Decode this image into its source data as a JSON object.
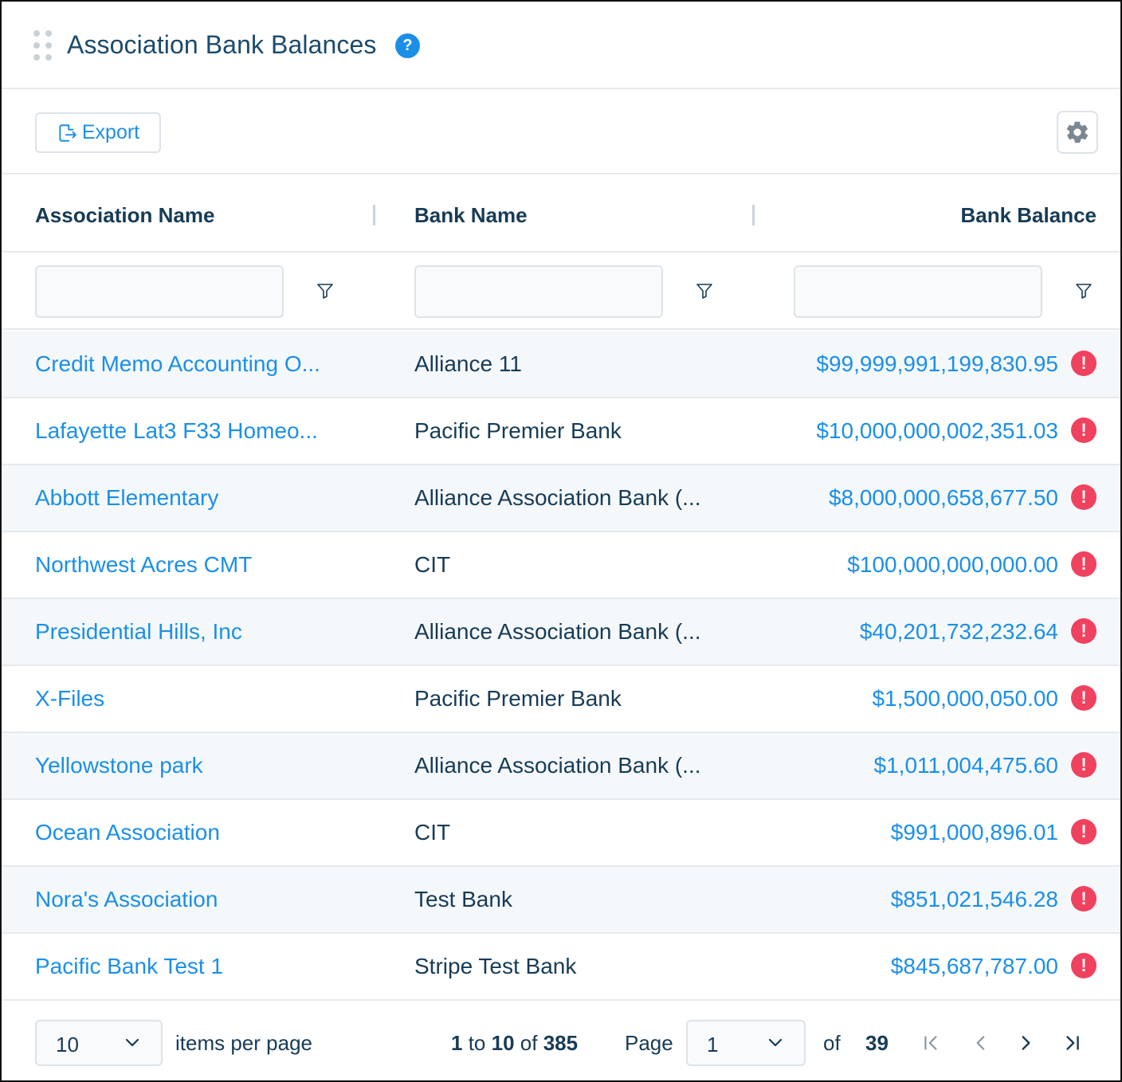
{
  "header": {
    "title": "Association Bank Balances",
    "help_glyph": "?"
  },
  "toolbar": {
    "export_label": "Export",
    "export_icon": "export-icon",
    "settings_icon": "gear-icon"
  },
  "columns": {
    "association_name": "Association Name",
    "bank_name": "Bank Name",
    "bank_balance": "Bank Balance"
  },
  "filters": {
    "association_value": "",
    "bank_value": "",
    "balance_value": ""
  },
  "rows": [
    {
      "association": "Credit Memo Accounting O...",
      "bank": "Alliance 11",
      "balance": "$99,999,991,199,830.95",
      "warning": "!"
    },
    {
      "association": "Lafayette Lat3 F33 Homeo...",
      "bank": "Pacific Premier Bank",
      "balance": "$10,000,000,002,351.03",
      "warning": "!"
    },
    {
      "association": "Abbott Elementary",
      "bank": "Alliance Association Bank (...",
      "balance": "$8,000,000,658,677.50",
      "warning": "!"
    },
    {
      "association": "Northwest Acres CMT",
      "bank": "CIT",
      "balance": "$100,000,000,000.00",
      "warning": "!"
    },
    {
      "association": "Presidential Hills, Inc",
      "bank": "Alliance Association Bank (...",
      "balance": "$40,201,732,232.64",
      "warning": "!"
    },
    {
      "association": "X-Files",
      "bank": "Pacific Premier Bank",
      "balance": "$1,500,000,050.00",
      "warning": "!"
    },
    {
      "association": "Yellowstone park",
      "bank": "Alliance Association Bank (...",
      "balance": "$1,011,004,475.60",
      "warning": "!"
    },
    {
      "association": "Ocean Association",
      "bank": "CIT",
      "balance": "$991,000,896.01",
      "warning": "!"
    },
    {
      "association": "Nora's Association",
      "bank": "Test Bank",
      "balance": "$851,021,546.28",
      "warning": "!"
    },
    {
      "association": "Pacific Bank Test 1",
      "bank": "Stripe Test Bank",
      "balance": "$845,687,787.00",
      "warning": "!"
    }
  ],
  "pagination": {
    "page_size": "10",
    "items_per_page_label": "items per page",
    "range_start": "1",
    "range_to": "to",
    "range_end": "10",
    "range_of": "of",
    "total": "385",
    "page_label": "Page",
    "current_page": "1",
    "of_label": "of",
    "page_count": "39"
  },
  "colors": {
    "accent": "#1b8fe8",
    "heading": "#173b56",
    "warning": "#f0415f",
    "row_alt": "#f5f8fb"
  }
}
